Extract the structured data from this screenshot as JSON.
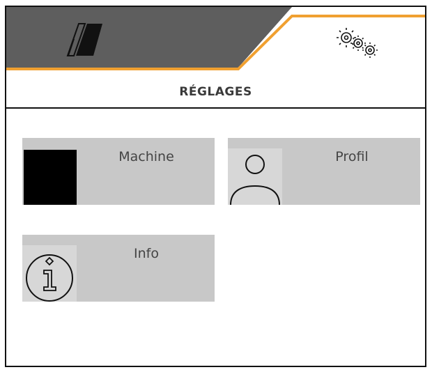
{
  "header": {
    "tab_left_icon": "machine-section-icon",
    "tab_right_icon": "gears-icon",
    "colors": {
      "dark": "#5e5e5e",
      "accent": "#f0a030",
      "tile": "#c8c8c8"
    }
  },
  "title": "RÉGLAGES",
  "menu": {
    "machine": {
      "label": "Machine",
      "icon": "machine-icon"
    },
    "profile": {
      "label": "Profil",
      "icon": "person-icon"
    },
    "info": {
      "label": "Info",
      "icon": "info-icon"
    }
  }
}
